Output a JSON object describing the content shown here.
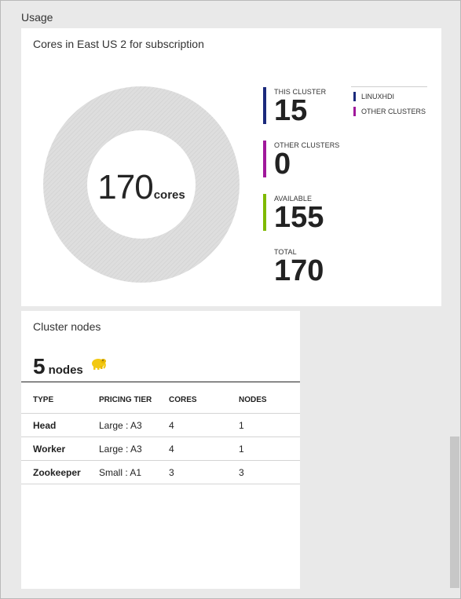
{
  "page": {
    "section_title": "Usage"
  },
  "cores_tile": {
    "title": "Cores in East US 2 for subscription",
    "donut": {
      "value": "170",
      "unit": "cores"
    },
    "stats": [
      {
        "label": "THIS CLUSTER",
        "value": "15",
        "color": "#1b2a7c"
      },
      {
        "label": "OTHER CLUSTERS",
        "value": "0",
        "color": "#a0189b"
      },
      {
        "label": "AVAILABLE",
        "value": "155",
        "color": "#7fba00"
      },
      {
        "label": "TOTAL",
        "value": "170",
        "color": "transparent"
      }
    ],
    "legend": [
      {
        "label": "LINUXHDI",
        "color": "#1b2a7c"
      },
      {
        "label": "OTHER CLUSTERS",
        "color": "#a0189b"
      }
    ]
  },
  "chart_data": {
    "type": "pie",
    "categories": [
      "THIS CLUSTER",
      "OTHER CLUSTERS",
      "AVAILABLE"
    ],
    "values": [
      15,
      0,
      155
    ],
    "total": 170,
    "title": "Cores in East US 2 for subscription"
  },
  "nodes_tile": {
    "title": "Cluster nodes",
    "count": "5",
    "unit": "nodes",
    "icon": "hadoop-elephant-icon",
    "columns": [
      "TYPE",
      "PRICING TIER",
      "CORES",
      "NODES"
    ],
    "rows": [
      [
        "Head",
        "Large : A3",
        "4",
        "1"
      ],
      [
        "Worker",
        "Large : A3",
        "4",
        "1"
      ],
      [
        "Zookeeper",
        "Small : A1",
        "3",
        "3"
      ]
    ]
  },
  "colors": {
    "background": "#e9e9e9",
    "tile": "#ffffff",
    "donut_ring": "#dcdcdc",
    "elephant": "#f2c811"
  }
}
